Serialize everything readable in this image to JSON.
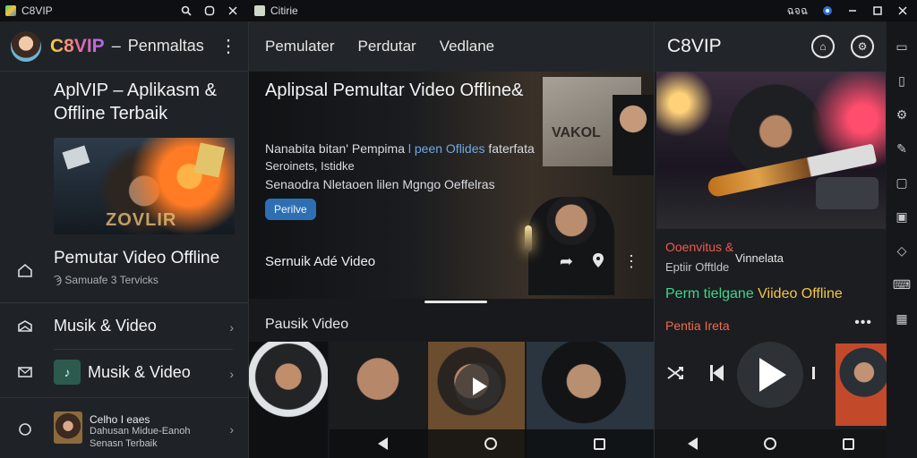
{
  "titlebar": {
    "left_app": "C8VIP",
    "mid_app": "Citirie",
    "right_status": "ฉจฉ",
    "icons": [
      "search-icon",
      "refresh-icon",
      "close-icon"
    ]
  },
  "left": {
    "brand": "C8VIP",
    "dash": "–",
    "header_title": "Penmaltas",
    "hero_title": "AplVIP – Aplikasm & Offline Terbaik",
    "thumb_text": "ZOVLIR",
    "section_title": "Pemutar Video Offline",
    "section_sub": "Samuafe 3 Tervicks",
    "section_sub_icon": "Ϡ",
    "rows": [
      {
        "label": "Musik & Video",
        "icon": "chat-icon"
      },
      {
        "label": "Musik & Video",
        "icon": "mail-icon"
      }
    ],
    "card": {
      "line1": "Celho I eaes",
      "line2": "Dahusan Midue-Eanoh",
      "line3": "Senasn Terbaik"
    }
  },
  "mid": {
    "tabs": [
      "Pemulater",
      "Perdutar",
      "Vedlane"
    ],
    "hero_title": "Aplipsal Pemultar Video Offline&",
    "desc1_plain": "Nanabita bitan' Pempima",
    "desc1_link": "l peen Oflides",
    "desc1_end": "faterfata",
    "desc2": "Seroinets, Istidke",
    "desc3": "Senaodra Nletaoen lilen Mgngo Oeffelras",
    "button": "Perilve",
    "poster_text": "VAKOL",
    "footer_label": "Sernuik Adé Video",
    "section": "Pausik Video"
  },
  "right": {
    "title": "C8VIP",
    "line1": "Ooenvitus &",
    "line1b": "Vinnelata",
    "line2": "Eptiir Offtlde",
    "line3_a": "Perm tielgane",
    "line3_b": "Viideo Offline",
    "line4": "Pentia Ireta",
    "dots": "•••"
  },
  "colors": {
    "accent_blue": "#2e6fb4",
    "green": "#3dd68c",
    "yellow": "#f3c64a",
    "red": "#f0594d"
  }
}
